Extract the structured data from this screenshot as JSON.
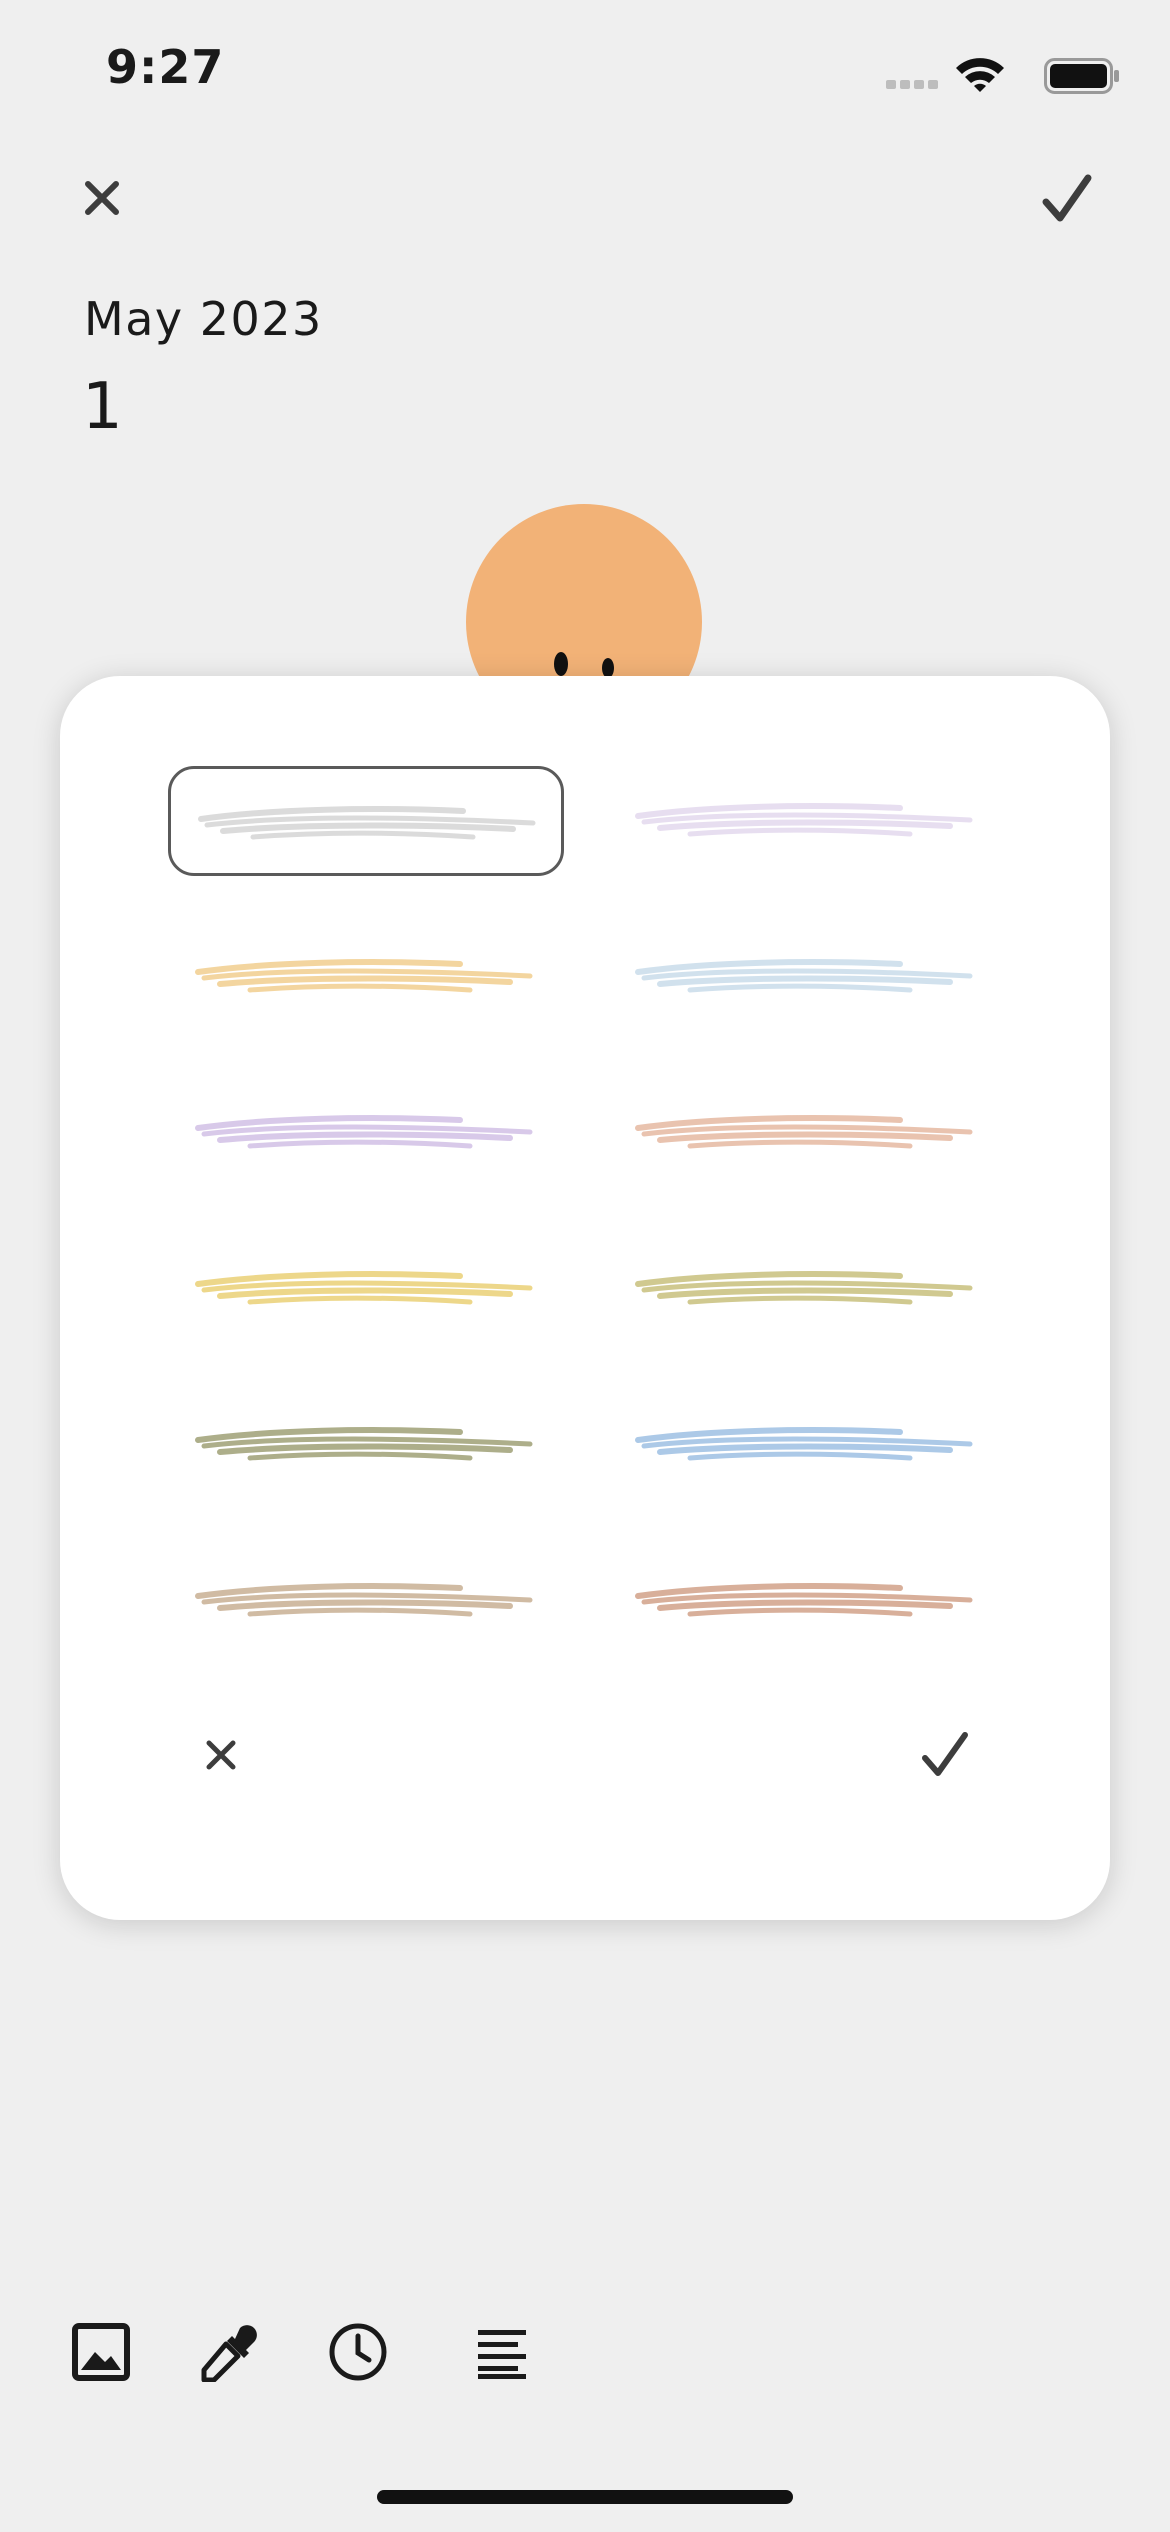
{
  "status_bar": {
    "time": "9:27"
  },
  "header": {
    "close_icon": "close-icon",
    "confirm_icon": "check-icon"
  },
  "entry": {
    "month": "May 2023",
    "day": "1"
  },
  "colors": {
    "background": "#efefef",
    "modal": "#ffffff",
    "mascot": "#f2b277",
    "icon": "#3d3d3d"
  },
  "palette": {
    "selected_index": 0,
    "swatches": [
      {
        "color": "#d9d9d9"
      },
      {
        "color": "#e6dcef"
      },
      {
        "color": "#f2d39a"
      },
      {
        "color": "#cfdfec"
      },
      {
        "color": "#d6c6e8"
      },
      {
        "color": "#e8c0ab"
      },
      {
        "color": "#ecd584"
      },
      {
        "color": "#cdc68a"
      },
      {
        "color": "#a9aa84"
      },
      {
        "color": "#a8c6e6"
      },
      {
        "color": "#cdb79e"
      },
      {
        "color": "#d6ab95"
      }
    ]
  },
  "toolbar": {
    "items": [
      "image-icon",
      "eyedropper-icon",
      "clock-icon",
      "align-left-icon"
    ]
  }
}
